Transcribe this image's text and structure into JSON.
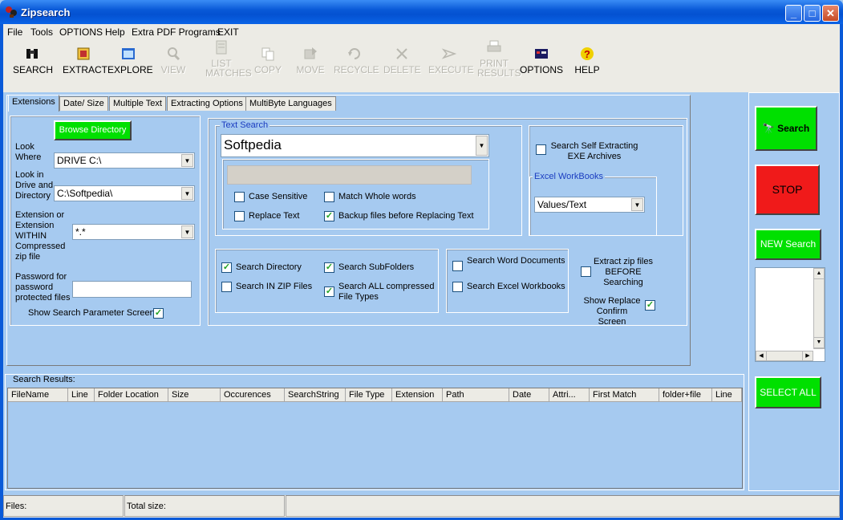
{
  "window": {
    "title": "Zipsearch"
  },
  "menu": [
    "File",
    "Tools",
    "OPTIONS",
    "Help",
    "Extra PDF Programs",
    "EXIT"
  ],
  "toolbar": [
    {
      "label": "SEARCH",
      "icon": "binoculars-icon",
      "enabled": true
    },
    {
      "label": "EXTRACT",
      "icon": "extract-icon",
      "enabled": true
    },
    {
      "label": "EXPLORE",
      "icon": "explore-icon",
      "enabled": true
    },
    {
      "label": "VIEW",
      "icon": "view-icon",
      "enabled": false
    },
    {
      "label": "LIST MATCHES",
      "icon": "list-icon",
      "enabled": false
    },
    {
      "label": "COPY",
      "icon": "copy-icon",
      "enabled": false
    },
    {
      "label": "MOVE",
      "icon": "move-icon",
      "enabled": false
    },
    {
      "label": "RECYCLE",
      "icon": "recycle-icon",
      "enabled": false
    },
    {
      "label": "DELETE",
      "icon": "delete-icon",
      "enabled": false
    },
    {
      "label": "EXECUTE",
      "icon": "execute-icon",
      "enabled": false
    },
    {
      "label": "PRINT RESULTS",
      "icon": "printer-icon",
      "enabled": false
    },
    {
      "label": "OPTIONS",
      "icon": "options-icon",
      "enabled": true
    },
    {
      "label": "HELP",
      "icon": "help-icon",
      "enabled": true
    }
  ],
  "tabs": [
    "Extensions",
    "Date/ Size",
    "Multiple Text",
    "Extracting Options",
    "MultiByte Languages"
  ],
  "left": {
    "browse_button": "Browse Directory",
    "look_where_label": "Look Where",
    "look_where_value": "DRIVE C:\\",
    "look_in_label": "Look in Drive and Directory",
    "look_in_value": "C:\\Softpedia\\",
    "extension_label": "Extension or Extension WITHIN Compressed zip file",
    "extension_value": "*.*",
    "password_label": "Password  for password protected files",
    "password_value": "",
    "show_param_label": "Show Search Parameter Screen",
    "show_param_checked": true
  },
  "text_search": {
    "legend": "Text Search",
    "value": "Softpedia",
    "replace_value": "",
    "case_sensitive": {
      "label": "Case Sensitive",
      "checked": false
    },
    "match_whole": {
      "label": "Match  Whole words",
      "checked": false
    },
    "replace_text": {
      "label": "Replace Text",
      "checked": false
    },
    "backup": {
      "label": "Backup files before Replacing Text",
      "checked": true
    }
  },
  "self_extract": {
    "label": "Search Self Extracting EXE Archives",
    "checked": false
  },
  "excel": {
    "legend": "Excel  WorkBooks",
    "value": "Values/Text"
  },
  "scope": {
    "search_directory": {
      "label": "Search Directory",
      "checked": true
    },
    "search_subfolders": {
      "label": "Search SubFolders",
      "checked": true
    },
    "search_in_zip": {
      "label": "Search IN ZIP Files",
      "checked": false
    },
    "search_all_compressed": {
      "label": "Search ALL compressed File Types",
      "checked": true
    }
  },
  "docs": {
    "word": {
      "label": "Search Word Documents",
      "checked": false
    },
    "excel": {
      "label": "Search Excel Workbooks",
      "checked": false
    }
  },
  "extract_before": {
    "label": "Extract zip files BEFORE Searching",
    "checked": false
  },
  "show_replace": {
    "label": "Show Replace Confirm Screen",
    "checked": true
  },
  "results": {
    "label": "Search Results:",
    "columns": [
      "FileName",
      "Line",
      "Folder Location",
      "Size",
      "Occurences",
      "SearchString",
      "File Type",
      "Extension",
      "Path",
      "Date",
      "Attri...",
      "First Match",
      "folder+file",
      "Line"
    ]
  },
  "right": {
    "search_button": "Search",
    "stop_button": "STOP",
    "new_search_button": "NEW Search",
    "select_all_button": "SELECT ALL"
  },
  "status": {
    "files_label": "Files:",
    "total_size_label": "Total size:"
  },
  "colors": {
    "accent_green": "#00e000",
    "stop_red": "#f01a1a",
    "panel_blue": "#a6caf0"
  }
}
